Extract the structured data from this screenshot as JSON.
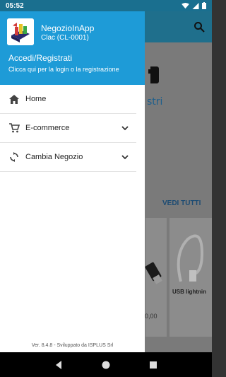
{
  "status_bar": {
    "time": "05:52",
    "icons": [
      "wifi-icon",
      "signal-icon",
      "battery-icon"
    ]
  },
  "drawer": {
    "app_name": "NegozioInApp",
    "store_code": "Clac (CL-0001)",
    "login_title": "Accedi/Registrati",
    "login_subtitle": "Clicca qui per la login o la registrazione",
    "menu": [
      {
        "label": "Home",
        "icon": "home-icon",
        "expandable": false
      },
      {
        "label": "E-commerce",
        "icon": "cart-icon",
        "expandable": true
      },
      {
        "label": "Cambia Negozio",
        "icon": "sync-icon",
        "expandable": true
      }
    ],
    "version": "Ver. 8.4.8 - Sviluppato da ISPLUS Srl"
  },
  "background": {
    "logo_fragment": "stri",
    "see_all": "VEDI TUTTI",
    "product_name": "USB lightnin",
    "product_price": "0,00"
  },
  "navbar": {
    "buttons": [
      "back-icon",
      "home-circle-icon",
      "recents-icon"
    ]
  },
  "colors": {
    "drawer_header": "#1e9bd7",
    "app_bar": "#1f6f8c",
    "status_bar": "#1a6f8f"
  }
}
